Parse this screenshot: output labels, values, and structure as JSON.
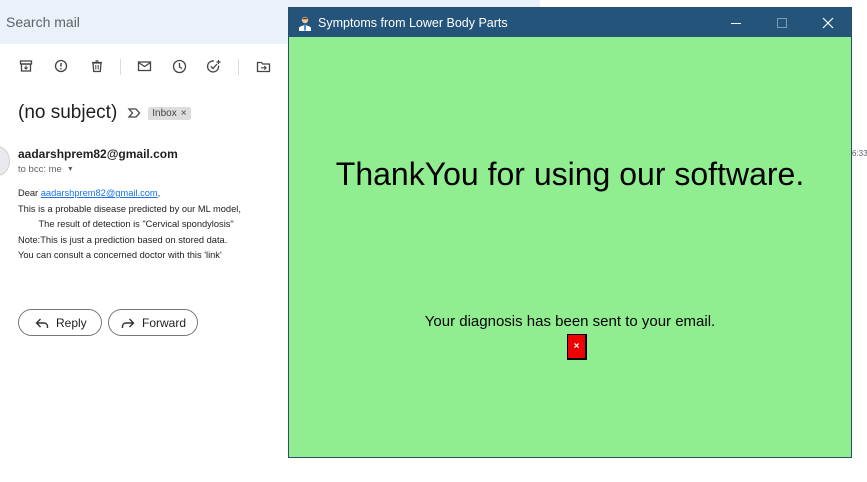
{
  "gmail": {
    "search_placeholder": "Search mail",
    "toolbar_icons": [
      "archive-icon",
      "report-spam-icon",
      "delete-icon",
      "mark-unread-icon",
      "snooze-icon",
      "add-to-tasks-icon",
      "move-to-icon"
    ],
    "subject": "(no subject)",
    "label_chip": "Inbox",
    "label_chip_close": "×",
    "sender": "aadarshprem82@gmail.com",
    "to_line": "to bcc: me",
    "time_peek": "6:33",
    "body": {
      "greeting_prefix": "Dear ",
      "greeting_link": "aadarshprem82@gmail.com",
      "greeting_suffix": ",",
      "line2": "This is a probable disease predicted by our ML model,",
      "line3": "        The result of detection is \"Cervical spondylosis\"",
      "line4": "Note:This is just a prediction based on stored data.",
      "line5": "You can consult a concerned doctor with this 'link'"
    },
    "reply_label": "Reply",
    "forward_label": "Forward"
  },
  "window": {
    "title": "Symptoms from Lower Body Parts",
    "bg_color": "#90ee90",
    "titlebar_color": "#245479",
    "thanks_text": "ThankYou for using our software.",
    "diagnosis_text": "Your diagnosis has been sent to your email.",
    "close_button_label": "×"
  }
}
